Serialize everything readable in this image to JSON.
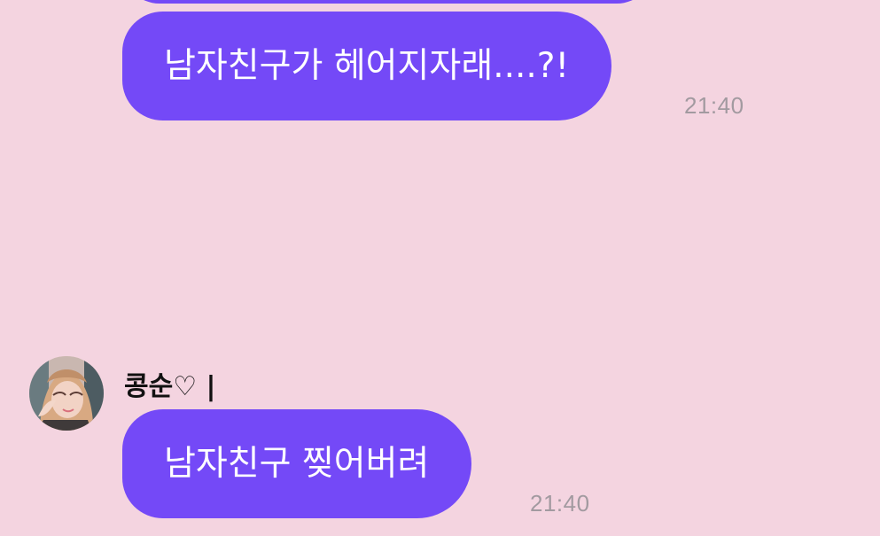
{
  "messages": {
    "outgoing": {
      "text": "남자친구가 헤어지자래....?!",
      "time": "21:40"
    },
    "incoming": {
      "sender": "콩순♡ |",
      "text": "남자친구 찢어버려",
      "time": "21:40"
    }
  },
  "colors": {
    "background": "#f4d4e0",
    "bubble": "#7449f7",
    "bubble_text": "#ffffff",
    "timestamp": "#a29aa0",
    "sender": "#111111"
  },
  "icons": {
    "avatar": "profile-photo-avatar"
  }
}
